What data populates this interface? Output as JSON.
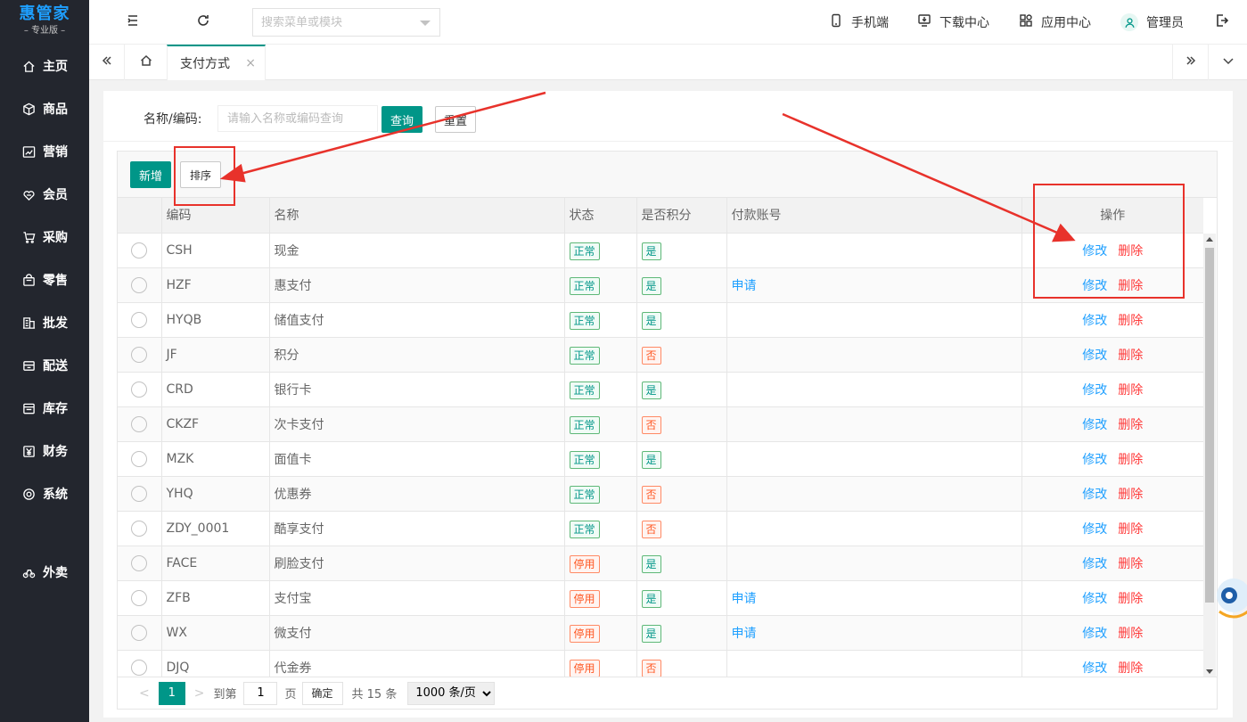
{
  "brand": {
    "title": "惠管家",
    "subtitle": "– 专业版 –",
    "accent": "#1e9fff"
  },
  "sidebar": {
    "items": [
      {
        "label": "主页",
        "icon": "home-icon"
      },
      {
        "label": "商品",
        "icon": "cube-icon"
      },
      {
        "label": "营销",
        "icon": "chart-icon"
      },
      {
        "label": "会员",
        "icon": "heart-icon"
      },
      {
        "label": "采购",
        "icon": "cart-icon"
      },
      {
        "label": "零售",
        "icon": "bag-icon"
      },
      {
        "label": "批发",
        "icon": "building-icon"
      },
      {
        "label": "配送",
        "icon": "delivery-icon"
      },
      {
        "label": "库存",
        "icon": "inventory-icon"
      },
      {
        "label": "财务",
        "icon": "yen-icon"
      },
      {
        "label": "系统",
        "icon": "settings-icon"
      }
    ],
    "extra": {
      "label": "外卖",
      "icon": "bike-icon"
    }
  },
  "topbar": {
    "search_placeholder": "搜索菜单或模块",
    "mobile": "手机端",
    "download": "下载中心",
    "apps": "应用中心",
    "user": "管理员"
  },
  "tabs": {
    "active": "支付方式",
    "close": "×"
  },
  "filter": {
    "label": "名称/编码:",
    "placeholder": "请输入名称或编码查询",
    "query": "查询",
    "reset": "重置"
  },
  "toolbar": {
    "add": "新增",
    "sort": "排序"
  },
  "table": {
    "headers": {
      "code": "编码",
      "name": "名称",
      "status": "状态",
      "points": "是否积分",
      "account": "付款账号",
      "ops": "操作"
    },
    "edit": "修改",
    "delete": "删除",
    "rows": [
      {
        "code": "CSH",
        "name": "现金",
        "status": "正常",
        "status_ok": true,
        "points": "是",
        "points_ok": true,
        "account": ""
      },
      {
        "code": "HZF",
        "name": "惠支付",
        "status": "正常",
        "status_ok": true,
        "points": "是",
        "points_ok": true,
        "account": "申请"
      },
      {
        "code": "HYQB",
        "name": "储值支付",
        "status": "正常",
        "status_ok": true,
        "points": "是",
        "points_ok": true,
        "account": ""
      },
      {
        "code": "JF",
        "name": "积分",
        "status": "正常",
        "status_ok": true,
        "points": "否",
        "points_ok": false,
        "account": ""
      },
      {
        "code": "CRD",
        "name": "银行卡",
        "status": "正常",
        "status_ok": true,
        "points": "是",
        "points_ok": true,
        "account": ""
      },
      {
        "code": "CKZF",
        "name": "次卡支付",
        "status": "正常",
        "status_ok": true,
        "points": "否",
        "points_ok": false,
        "account": ""
      },
      {
        "code": "MZK",
        "name": "面值卡",
        "status": "正常",
        "status_ok": true,
        "points": "是",
        "points_ok": true,
        "account": ""
      },
      {
        "code": "YHQ",
        "name": "优惠券",
        "status": "正常",
        "status_ok": true,
        "points": "否",
        "points_ok": false,
        "account": ""
      },
      {
        "code": "ZDY_0001",
        "name": "酷享支付",
        "status": "正常",
        "status_ok": true,
        "points": "否",
        "points_ok": false,
        "account": ""
      },
      {
        "code": "FACE",
        "name": "刷脸支付",
        "status": "停用",
        "status_ok": false,
        "points": "是",
        "points_ok": true,
        "account": ""
      },
      {
        "code": "ZFB",
        "name": "支付宝",
        "status": "停用",
        "status_ok": false,
        "points": "是",
        "points_ok": true,
        "account": "申请"
      },
      {
        "code": "WX",
        "name": "微支付",
        "status": "停用",
        "status_ok": false,
        "points": "是",
        "points_ok": true,
        "account": "申请"
      },
      {
        "code": "DJQ",
        "name": "代金券",
        "status": "停用",
        "status_ok": false,
        "points": "否",
        "points_ok": false,
        "account": ""
      }
    ]
  },
  "pager": {
    "current": "1",
    "goto": "到第",
    "page_input": "1",
    "page_unit": "页",
    "confirm": "确定",
    "total": "共 15 条",
    "page_size": "1000 条/页"
  },
  "colors": {
    "primary": "#009688",
    "danger": "#ff3b3b",
    "link": "#1e9fff",
    "annotation": "#e8322b"
  }
}
